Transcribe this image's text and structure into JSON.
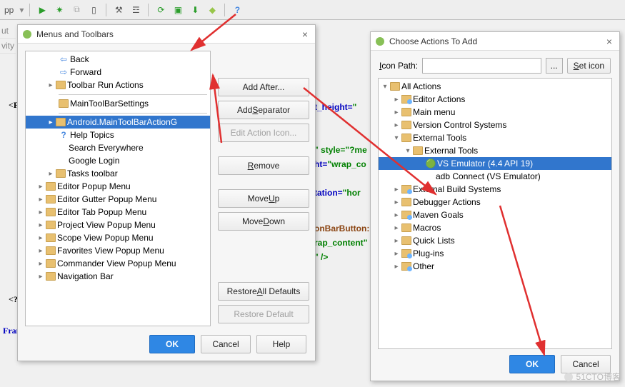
{
  "toolbar": {
    "app_label": "pp"
  },
  "gutter": [
    "ut",
    "vity"
  ],
  "code": {
    "l1a": "t_height=",
    "l1b": "\"",
    "l2a": "\" style=",
    "l2b": "\"?me",
    "l3a": "ht=",
    "l3b": "\"wrap_co",
    "l4a": "tation=",
    "l4b": "\"hor",
    "l5": "onBarButton:",
    "l6a": "rap_content",
    "l6b": "\"",
    "l7": "\" />",
    "frams": "Frams",
    "pf": "<F",
    "q": "<?"
  },
  "dlg1": {
    "title": "Menus and Toolbars",
    "tree": {
      "back": "Back",
      "forward": "Forward",
      "run_actions": "Toolbar Run Actions",
      "settings": "MainToolBarSettings",
      "android": "Android.MainToolBarActionG",
      "help": "Help Topics",
      "search": "Search Everywhere",
      "google": "Google Login",
      "tasks": "Tasks toolbar",
      "editor_popup": "Editor Popup Menu",
      "gutter_popup": "Editor Gutter Popup Menu",
      "tab_popup": "Editor Tab Popup Menu",
      "project_popup": "Project View Popup Menu",
      "scope_popup": "Scope View Popup Menu",
      "fav_popup": "Favorites View Popup Menu",
      "cmd_popup": "Commander View Popup Menu",
      "navbar": "Navigation Bar"
    },
    "buttons": {
      "add_after": "Add After...",
      "add_sep_pre": "Add ",
      "add_sep_u": "S",
      "add_sep_post": "eparator",
      "edit_icon": "Edit Action Icon...",
      "remove_u": "R",
      "remove_post": "emove",
      "moveup_pre": "Move ",
      "moveup_u": "U",
      "moveup_post": "p",
      "movedn_pre": "Move ",
      "movedn_u": "D",
      "movedn_post": "own",
      "restore_all_pre": "Restore ",
      "restore_all_u": "A",
      "restore_all_post": "ll Defaults",
      "restore_def": "Restore Default"
    },
    "footer": {
      "ok": "OK",
      "cancel": "Cancel",
      "help": "Help"
    }
  },
  "dlg2": {
    "title": "Choose Actions To Add",
    "icon_label_u": "I",
    "icon_label_post": "con Path:",
    "seticon_u": "S",
    "seticon_post": "et icon",
    "browse": "...",
    "tree": {
      "all": "All Actions",
      "editor": "Editor Actions",
      "main": "Main menu",
      "vcs": "Version Control Systems",
      "ext": "External Tools",
      "ext2": "External Tools",
      "vs": "VS Emulator (4.4 API 19)",
      "adb": "adb Connect (VS Emulator)",
      "build": "External Build Systems",
      "debug": "Debugger Actions",
      "maven": "Maven Goals",
      "macros": "Macros",
      "quick": "Quick Lists",
      "plugins": "Plug-ins",
      "other": "Other"
    },
    "footer": {
      "ok": "OK",
      "cancel": "Cancel"
    }
  },
  "watermark": "51CTO博客"
}
